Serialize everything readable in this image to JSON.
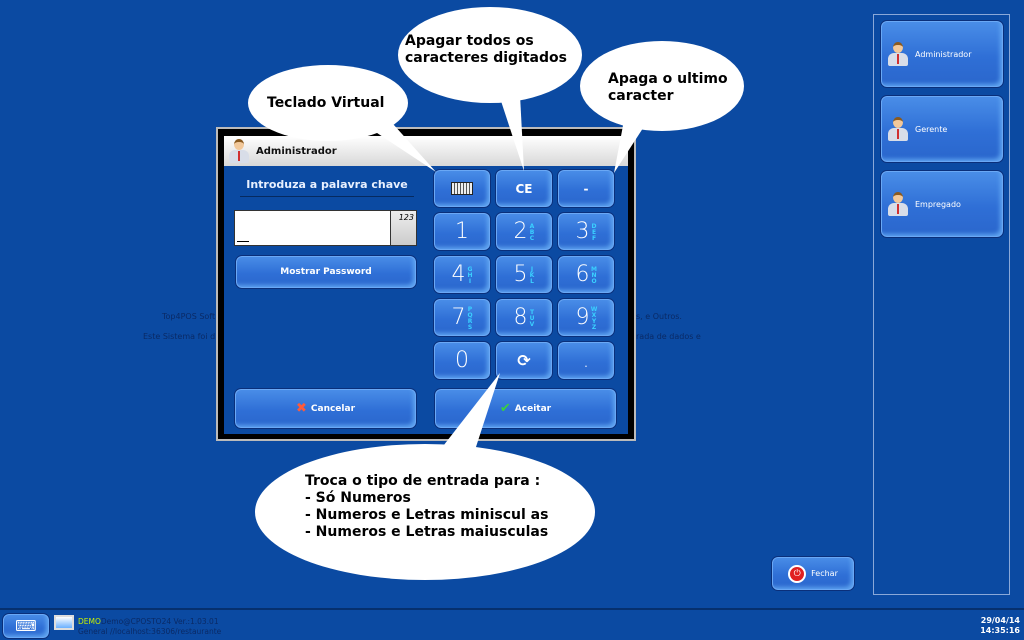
{
  "background_text": {
    "line1_left": "Top4POS Soft",
    "line1_right": "s, e Outros.",
    "line2_left": "Este Sistema foi d",
    "line2_right": "rada de dados e"
  },
  "callouts": {
    "virtual_keyboard": "Teclado Virtual",
    "clear_all": [
      "Apagar todos os",
      "caracteres digitados"
    ],
    "backspace": [
      "Apaga o ultimo",
      "caracter"
    ],
    "input_mode": [
      "Troca o tipo de entrada para :",
      "- Só Numeros",
      "- Numeros e Letras miniscul as",
      "- Numeros e Letras maiusculas"
    ]
  },
  "dialog": {
    "title": "Administrador",
    "prompt": "Introduza a palavra chave",
    "password_value": "",
    "mode_indicator": "123",
    "show_password_label": "Mostrar Password",
    "cancel_label": "Cancelar",
    "accept_label": "Aceitar",
    "keys": [
      {
        "main": "keyboard-icon",
        "sub": ""
      },
      {
        "main": "CE",
        "sub": ""
      },
      {
        "main": "-",
        "sub": ""
      },
      {
        "main": "1",
        "sub": ""
      },
      {
        "main": "2",
        "sub": "ABC"
      },
      {
        "main": "3",
        "sub": "DEF"
      },
      {
        "main": "4",
        "sub": "GHI"
      },
      {
        "main": "5",
        "sub": "JKL"
      },
      {
        "main": "6",
        "sub": "MNO"
      },
      {
        "main": "7",
        "sub": "PQRS"
      },
      {
        "main": "8",
        "sub": "TUV"
      },
      {
        "main": "9",
        "sub": "WXYZ"
      },
      {
        "main": "0",
        "sub": ""
      },
      {
        "main": "refresh-icon",
        "sub": ""
      },
      {
        "main": ".",
        "sub": ""
      }
    ]
  },
  "users": [
    {
      "label": "Administrador"
    },
    {
      "label": "Gerente"
    },
    {
      "label": "Empregado"
    }
  ],
  "close_label": "Fechar",
  "taskbar": {
    "demo": "DEMO",
    "user_version": "Demo@CPOSTO24 Ver.:1.03.01",
    "connection": "General //localhost:36306/restaurante",
    "date": "29/04/14",
    "time": "14:35:16"
  },
  "colors": {
    "background": "#0b4aa2",
    "button": "#2f6fd6",
    "subletters": "#3ad0ff",
    "demo": "#c8f000"
  }
}
